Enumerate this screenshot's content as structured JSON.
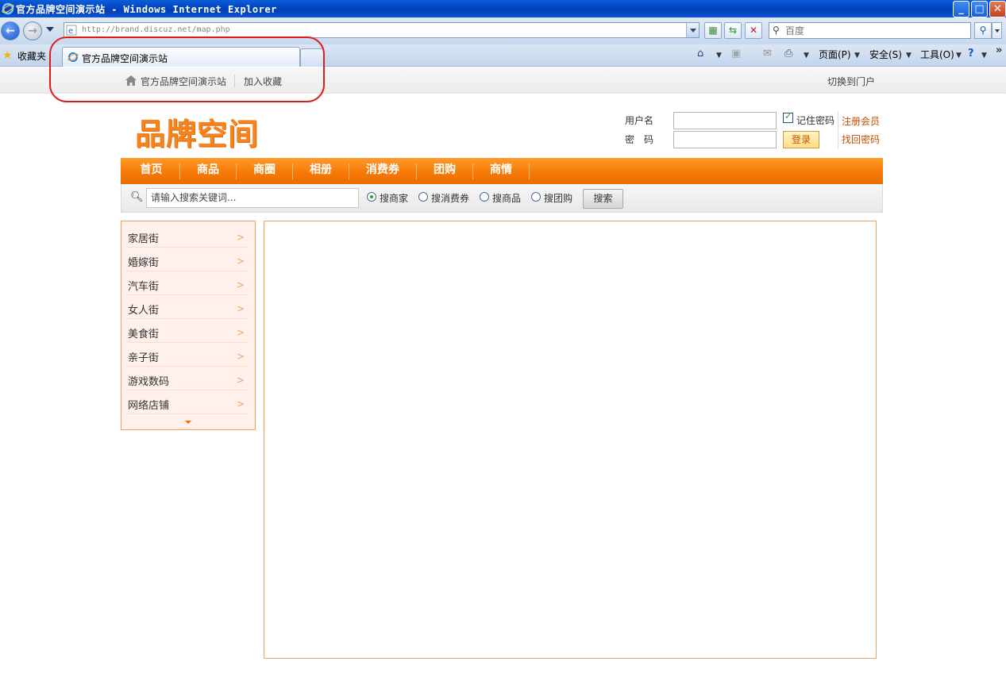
{
  "browser": {
    "window_title": "官方品牌空间演示站 - Windows Internet Explorer",
    "url": "http://brand.discuz.net/map.php",
    "search_placeholder": "百度",
    "favorites_label": "收藏夹",
    "tab_title": "官方品牌空间演示站",
    "commands": {
      "page": "页面(P)",
      "safety": "安全(S)",
      "tools": "工具(O)"
    },
    "chevron": "»"
  },
  "sitebar": {
    "site_name": "官方品牌空间演示站",
    "add_favorite": "加入收藏",
    "switch_portal": "切换到门户"
  },
  "header": {
    "logo_text": "品牌空间",
    "username_label": "用户名",
    "password_label": "密　码",
    "remember_label": "记住密码",
    "login_button": "登录",
    "register_link": "注册会员",
    "recover_link": "找回密码"
  },
  "nav": {
    "items": [
      "首页",
      "商品",
      "商圈",
      "相册",
      "消费券",
      "团购",
      "商情"
    ]
  },
  "search": {
    "keyword_value": "请输入搜索关键词...",
    "options": [
      "搜商家",
      "搜消费券",
      "搜商品",
      "搜团购"
    ],
    "selected": "搜商家",
    "button": "搜索"
  },
  "categories": {
    "items": [
      "家居街",
      "婚嫁街",
      "汽车街",
      "女人街",
      "美食街",
      "亲子街",
      "游戏数码",
      "网络店铺"
    ],
    "arrow": ">"
  },
  "colors": {
    "accent": "#f67a07",
    "link": "#c44c00",
    "annotation": "#e01a1a"
  }
}
